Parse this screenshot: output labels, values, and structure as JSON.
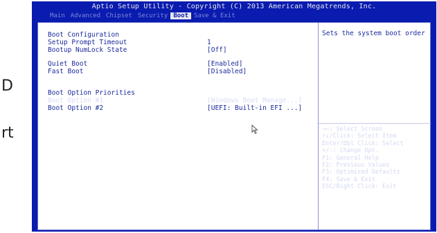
{
  "page_side_text": [
    "D",
    "rt"
  ],
  "header": {
    "title": "Aptio Setup Utility - Copyright (C) 2013 American Megatrends, Inc.",
    "tabs": [
      {
        "label": "Main",
        "active": false
      },
      {
        "label": "Advanced",
        "active": false
      },
      {
        "label": "Chipset",
        "active": false
      },
      {
        "label": "Security",
        "active": false
      },
      {
        "label": "Boot",
        "active": true
      },
      {
        "label": "Save & Exit",
        "active": false
      }
    ]
  },
  "boot": {
    "section_title": "Boot Configuration",
    "setup_prompt_timeout": {
      "label": "Setup Prompt Timeout",
      "value": "1"
    },
    "bootup_numlock": {
      "label": "Bootup NumLock State",
      "value": "[Off]"
    },
    "quiet_boot": {
      "label": "Quiet Boot",
      "value": "[Enabled]"
    },
    "fast_boot": {
      "label": "Fast Boot",
      "value": "[Disabled]"
    },
    "priorities_title": "Boot Option Priorities",
    "boot_option_1": {
      "label": "Boot Option #1",
      "value": "[Windows Boot Manage...]"
    },
    "boot_option_2": {
      "label": "Boot Option #2",
      "value": "[UEFI: Built-in EFI ...]"
    }
  },
  "help_text": "Sets the system boot order",
  "key_help": [
    "→←: Select Screen",
    "↑↓/Click: Select Item",
    "Enter/Dbl Click: Select",
    "+/-: Change Opt.",
    "F1: General Help",
    "F2: Previous Values",
    "F3: Optimized Defaults",
    "F4: Save & Exit",
    "ESC/Right Click: Exit"
  ],
  "colors": {
    "bios_blue": "#0a1bb0",
    "text_blue": "#1a2a9c",
    "highlight": "#d8dcf4"
  },
  "icons": {
    "cursor": "mouse-pointer-icon"
  }
}
